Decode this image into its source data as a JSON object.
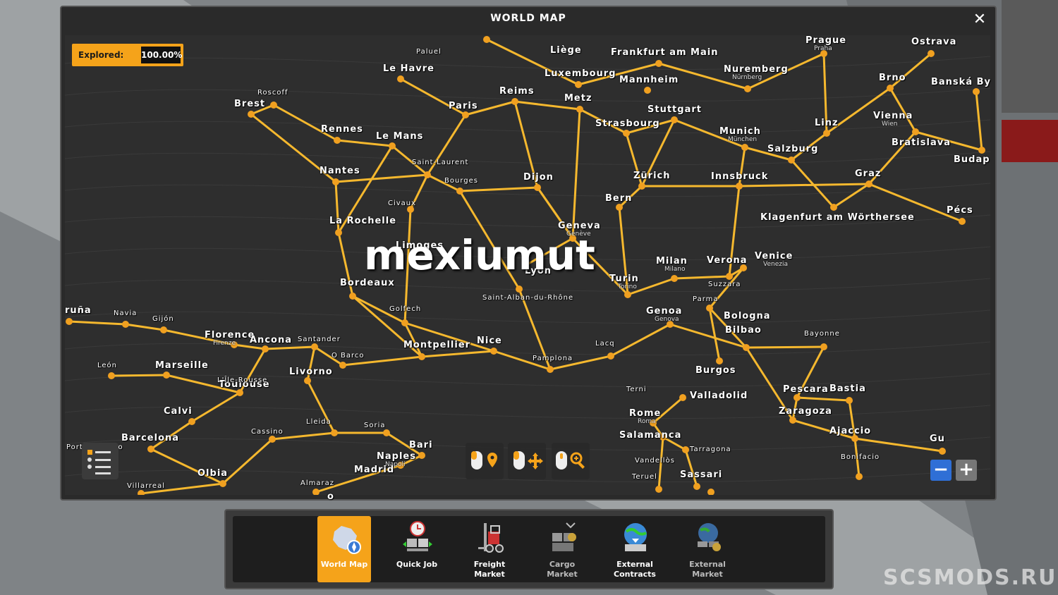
{
  "window": {
    "title": "WORLD MAP",
    "close_label": "✕"
  },
  "explored": {
    "label": "Explored:",
    "value": "100.00%",
    "accent": "#f5a31a"
  },
  "watermark": "mexiumut",
  "site": "SCSMODS.RU",
  "cities": [
    {
      "name": "Paluel",
      "size": "sm"
    },
    {
      "name": "Le Havre"
    },
    {
      "name": "Liège"
    },
    {
      "name": "Frankfurt am Main"
    },
    {
      "name": "Prague",
      "sub": "Praha"
    },
    {
      "name": "Ostrava"
    },
    {
      "name": "Roscoff",
      "size": "sm"
    },
    {
      "name": "Brest"
    },
    {
      "name": "Luxembourg"
    },
    {
      "name": "Mannheim"
    },
    {
      "name": "Nuremberg",
      "sub": "Nürnberg"
    },
    {
      "name": "Brno"
    },
    {
      "name": "Banská By"
    },
    {
      "name": "Reims"
    },
    {
      "name": "Paris"
    },
    {
      "name": "Metz"
    },
    {
      "name": "Stuttgart"
    },
    {
      "name": "Rennes"
    },
    {
      "name": "Le Mans"
    },
    {
      "name": "Strasbourg"
    },
    {
      "name": "Linz"
    },
    {
      "name": "Vienna",
      "sub": "Wien"
    },
    {
      "name": "Munich",
      "sub": "München"
    },
    {
      "name": "Salzburg"
    },
    {
      "name": "Bratislava"
    },
    {
      "name": "Budap"
    },
    {
      "name": "Saint-Laurent",
      "size": "sm"
    },
    {
      "name": "Nantes"
    },
    {
      "name": "Bourges",
      "size": "sm"
    },
    {
      "name": "Dijon"
    },
    {
      "name": "Zürich"
    },
    {
      "name": "Innsbruck"
    },
    {
      "name": "Graz"
    },
    {
      "name": "Bern"
    },
    {
      "name": "Civaux",
      "size": "sm"
    },
    {
      "name": "Pécs"
    },
    {
      "name": "La Rochelle"
    },
    {
      "name": "Geneva",
      "sub": "Genève"
    },
    {
      "name": "Klagenfurt am Wörthersee"
    },
    {
      "name": "Limoges"
    },
    {
      "name": "Lyon"
    },
    {
      "name": "Milan",
      "sub": "Milano"
    },
    {
      "name": "Verona"
    },
    {
      "name": "Venice",
      "sub": "Venezia"
    },
    {
      "name": "Turin",
      "sub": "Torino"
    },
    {
      "name": "Suzzara",
      "size": "sm"
    },
    {
      "name": "Bordeaux"
    },
    {
      "name": "Saint-Alban-du-Rhône",
      "size": "sm"
    },
    {
      "name": "Parma",
      "size": "sm"
    },
    {
      "name": "Genoa",
      "sub": "Genova"
    },
    {
      "name": "Bologna"
    },
    {
      "name": "Golfech",
      "size": "sm"
    },
    {
      "name": "ruña"
    },
    {
      "name": "Navia",
      "size": "sm"
    },
    {
      "name": "Gijón",
      "size": "sm"
    },
    {
      "name": "Florence",
      "sub": "Firenze"
    },
    {
      "name": "Ancona"
    },
    {
      "name": "Santander",
      "size": "sm"
    },
    {
      "name": "Bilbao"
    },
    {
      "name": "Bayonne",
      "size": "sm"
    },
    {
      "name": "Toulouse"
    },
    {
      "name": "Montpellier"
    },
    {
      "name": "Nice"
    },
    {
      "name": "Lacq",
      "size": "sm"
    },
    {
      "name": "O Barco",
      "size": "sm"
    },
    {
      "name": "León",
      "size": "sm"
    },
    {
      "name": "Marseille"
    },
    {
      "name": "Pamplona",
      "size": "sm"
    },
    {
      "name": "Livorno"
    },
    {
      "name": "Burgos"
    },
    {
      "name": "L'Île-Rousse",
      "size": "sm"
    },
    {
      "name": "Terni",
      "size": "sm"
    },
    {
      "name": "Pescara"
    },
    {
      "name": "Bastia"
    },
    {
      "name": "Valladolid"
    },
    {
      "name": "Calvi"
    },
    {
      "name": "Rome",
      "sub": "Roma"
    },
    {
      "name": "Zaragoza"
    },
    {
      "name": "Lleida",
      "size": "sm"
    },
    {
      "name": "Soria",
      "size": "sm"
    },
    {
      "name": "Cassino",
      "size": "sm"
    },
    {
      "name": "Ajaccio"
    },
    {
      "name": "Salamanca"
    },
    {
      "name": "Barcelona"
    },
    {
      "name": "Bari"
    },
    {
      "name": "Gu"
    },
    {
      "name": "Porto-Vecchio",
      "size": "sm"
    },
    {
      "name": "Tarragona",
      "size": "sm"
    },
    {
      "name": "Naples",
      "sub": "Napoli"
    },
    {
      "name": "Bonifacio",
      "size": "sm"
    },
    {
      "name": "Vandellòs",
      "size": "sm"
    },
    {
      "name": "Madrid"
    },
    {
      "name": "Olbia"
    },
    {
      "name": "Sassari"
    },
    {
      "name": "Teruel",
      "size": "sm"
    },
    {
      "name": "Almaraz",
      "size": "sm"
    },
    {
      "name": "Villarreal",
      "size": "sm"
    },
    {
      "name": "o"
    }
  ],
  "controls": {
    "legend_icon": "legend-list-icon",
    "mouse_left_icon": "mouse-left-waypoint-icon",
    "mouse_drag_icon": "mouse-drag-pan-icon",
    "mouse_zoom_icon": "mouse-wheel-zoom-icon",
    "zoom_out": "−",
    "zoom_in": "+"
  },
  "dock": [
    {
      "label": "World Map",
      "icon": "world-map-icon",
      "active": true
    },
    {
      "label": "Quick Job",
      "icon": "quick-job-icon",
      "active": false
    },
    {
      "label": "Freight Market",
      "icon": "forklift-icon",
      "active": false
    },
    {
      "label": "Cargo Market",
      "icon": "cargo-market-icon",
      "active": false,
      "dim": true
    },
    {
      "label": "External Contracts",
      "icon": "external-contracts-icon",
      "active": false
    },
    {
      "label": "External Market",
      "icon": "external-market-icon",
      "active": false,
      "dim": true
    }
  ],
  "colors": {
    "road": "#f5b82e",
    "city_dot": "#f0a020",
    "map_bg": "#2e2e2e"
  }
}
